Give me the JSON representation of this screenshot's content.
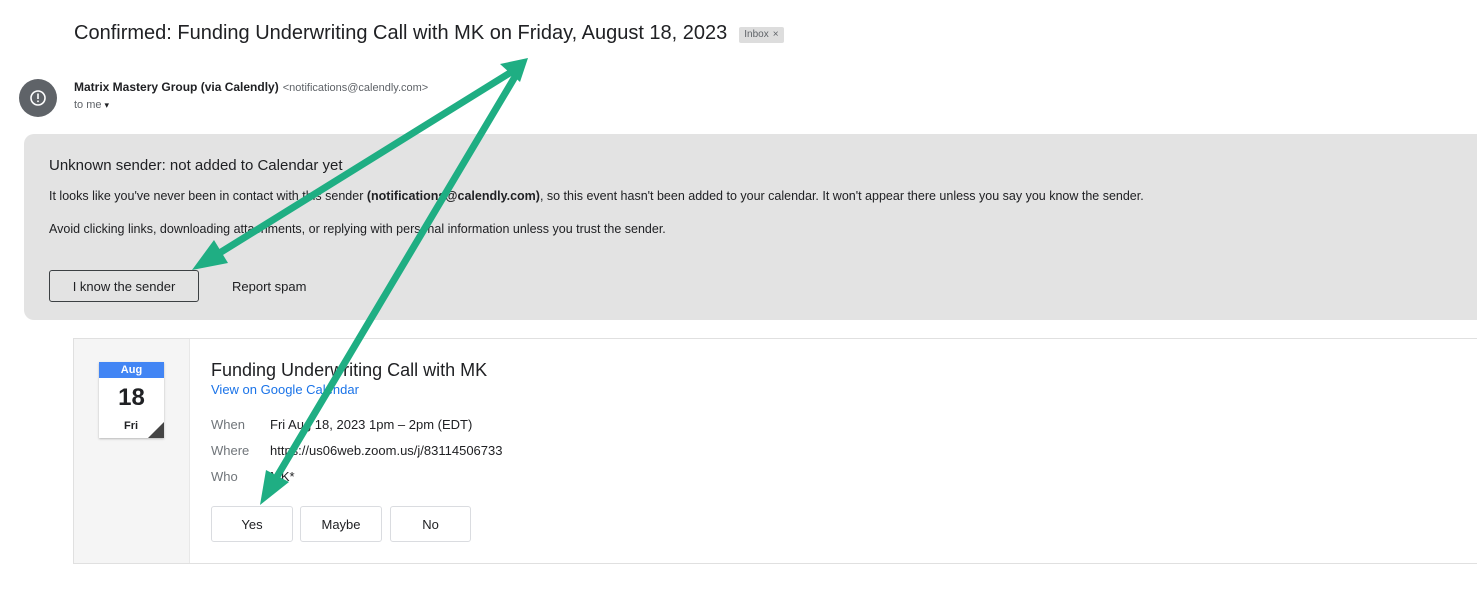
{
  "subject": {
    "text": "Confirmed: Funding Underwriting Call with MK on Friday, August 18, 2023",
    "label": "Inbox",
    "label_remove": "×"
  },
  "sender": {
    "avatar_glyph": "!",
    "name": "Matrix Mastery Group (via Calendly)",
    "email": "<notifications@calendly.com>",
    "to": "to me",
    "to_caret": "▾"
  },
  "warning": {
    "title": "Unknown sender: not added to Calendar yet",
    "line1_prefix": "It looks like you've never been in contact with this sender ",
    "line1_email": "(notifications@calendly.com)",
    "line1_suffix": ", so this event hasn't been added to your calendar. It won't appear there unless you say you know the sender.",
    "line2": "Avoid clicking links, downloading attachments, or replying with personal information unless you trust the sender.",
    "know_button": "I know the sender",
    "spam_button": "Report spam"
  },
  "event": {
    "month": "Aug",
    "day": "18",
    "dow": "Fri",
    "title": "Funding Underwriting Call with MK",
    "calendar_link": "View on Google Calendar",
    "when_label": "When",
    "when_value": "Fri Aug 18, 2023 1pm – 2pm (EDT)",
    "where_label": "Where",
    "where_value": "https://us06web.zoom.us/j/83114506733",
    "who_label": "Who",
    "who_value": "MK*",
    "rsvp": {
      "yes": "Yes",
      "maybe": "Maybe",
      "no": "No"
    }
  },
  "colors": {
    "annotation_arrow": "#1fae83",
    "link": "#1a73e8",
    "warning_bg": "#e3e3e3",
    "calendar_month": "#4285f4"
  }
}
